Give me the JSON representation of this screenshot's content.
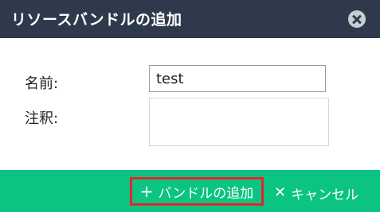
{
  "dialog": {
    "title": "リソースバンドルの追加",
    "close_icon": "close-icon"
  },
  "form": {
    "name_label": "名前:",
    "name_value": "test",
    "description_label": "注釈:",
    "description_value": ""
  },
  "footer": {
    "add_icon": "plus-icon",
    "add_label": "バンドルの追加",
    "cancel_icon": "x-icon",
    "cancel_label": "キャンセル"
  },
  "colors": {
    "header_bg": "#2e3a4c",
    "footer_bg": "#0bc481",
    "highlight_border": "#e8232c"
  }
}
